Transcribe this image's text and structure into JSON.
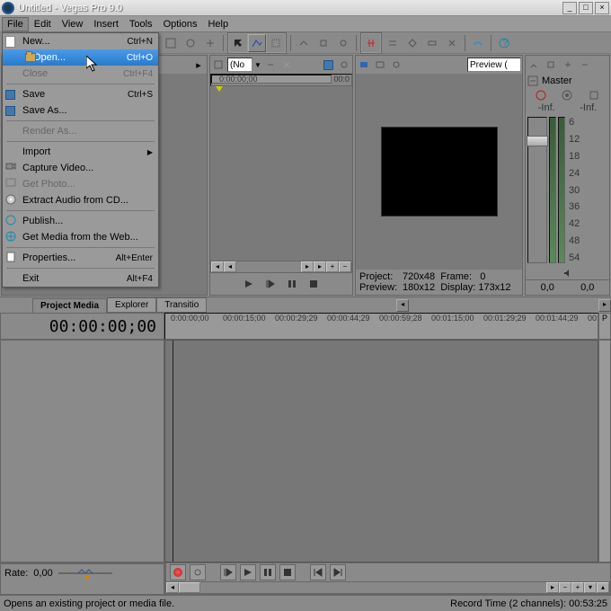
{
  "title": "Untitled - Vegas Pro 9.0",
  "menubar": [
    "File",
    "Edit",
    "View",
    "Insert",
    "Tools",
    "Options",
    "Help"
  ],
  "file_menu": {
    "new": {
      "label": "New...",
      "shortcut": "Ctrl+N"
    },
    "open": {
      "label": "Open...",
      "shortcut": "Ctrl+O"
    },
    "close": {
      "label": "Close",
      "shortcut": "Ctrl+F4"
    },
    "save": {
      "label": "Save",
      "shortcut": "Ctrl+S"
    },
    "save_as": {
      "label": "Save As..."
    },
    "render_as": {
      "label": "Render As..."
    },
    "import": {
      "label": "Import"
    },
    "capture_video": {
      "label": "Capture Video..."
    },
    "get_photo": {
      "label": "Get Photo..."
    },
    "extract_audio": {
      "label": "Extract Audio from CD..."
    },
    "publish": {
      "label": "Publish..."
    },
    "get_media_web": {
      "label": "Get Media from the Web..."
    },
    "properties": {
      "label": "Properties...",
      "shortcut": "Alt+Enter"
    },
    "exit": {
      "label": "Exit",
      "shortcut": "Alt+F4"
    }
  },
  "tabs": {
    "project_media": "Project Media",
    "explorer": "Explorer",
    "transitions": "Transitio"
  },
  "mid_panel": {
    "dropdown": "(No",
    "timecode": "0:00:00;00",
    "timecode_end": "00:0"
  },
  "preview": {
    "title": "Preview (",
    "project_label": "Project:",
    "project_value": "720x48",
    "frame_label": "Frame:",
    "frame_value": "0",
    "preview_label": "Preview:",
    "preview_value": "180x12",
    "display_label": "Display:",
    "display_value": "173x12"
  },
  "master": {
    "title": "Master",
    "inf_left": "-Inf.",
    "inf_right": "-Inf.",
    "scale": [
      "6",
      "12",
      "18",
      "24",
      "30",
      "36",
      "42",
      "48",
      "54"
    ],
    "foot_left": "0,0",
    "foot_right": "0,0"
  },
  "timeline": {
    "big_timecode": "00:00:00;00",
    "ticks": [
      "0:00:00;00",
      "00:00:15;00",
      "00:00:29;29",
      "00:00:44;29",
      "00:00:59;28",
      "00:01:15;00",
      "00:01:29;29",
      "00:01:44;29",
      "00:0"
    ]
  },
  "rate": {
    "label": "Rate:",
    "value": "0,00"
  },
  "status": {
    "left": "Opens an existing project or media file.",
    "right": "Record Time (2 channels): 00:53:25"
  }
}
